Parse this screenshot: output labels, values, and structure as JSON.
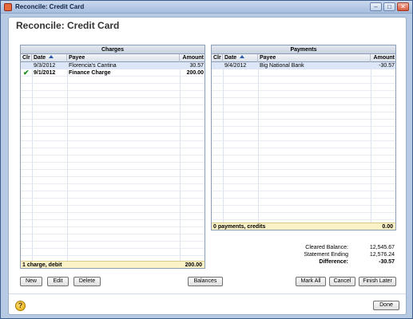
{
  "window": {
    "title": "Reconcile: Credit Card",
    "controls": {
      "minimize": "–",
      "maximize": "□",
      "close": "✕"
    }
  },
  "heading": "Reconcile: Credit Card",
  "charges": {
    "title": "Charges",
    "columns": {
      "clr": "Clr",
      "date": "Date",
      "payee": "Payee",
      "amount": "Amount"
    },
    "rows": [
      {
        "clr": "",
        "date": "9/3/2012",
        "payee": "Florencia's Cantina",
        "amount": "30.57",
        "cleared": false
      },
      {
        "clr": "✔",
        "date": "9/1/2012",
        "payee": "Finance Charge",
        "amount": "200.00",
        "cleared": true
      }
    ],
    "footer": {
      "label": "1 charge, debit",
      "total": "200.00"
    }
  },
  "payments": {
    "title": "Payments",
    "columns": {
      "clr": "Clr",
      "date": "Date",
      "payee": "Payee",
      "amount": "Amount"
    },
    "rows": [
      {
        "clr": "",
        "date": "9/4/2012",
        "payee": "Big National Bank",
        "amount": "-30.57",
        "cleared": false
      }
    ],
    "footer": {
      "label": "0 payments, credits",
      "total": "0.00"
    }
  },
  "summary": {
    "cleared_balance_label": "Cleared Balance:",
    "cleared_balance": "12,545.67",
    "statement_ending_label": "Statement Ending",
    "statement_ending": "12,576.24",
    "difference_label": "Difference:",
    "difference": "-30.57"
  },
  "buttons": {
    "new": "New",
    "edit": "Edit",
    "delete": "Delete",
    "balances": "Balances",
    "mark_all": "Mark All",
    "cancel": "Cancel",
    "finish_later": "Finish Later",
    "done": "Done"
  },
  "help_icon": "?",
  "icons": [
    "app-icon",
    "sort-ascending-icon",
    "checkmark-icon",
    "help-icon"
  ],
  "colors": {
    "title_bar": "#b7cae4",
    "footer_bar": "#fbf2c7",
    "selected_row": "#dce6f6",
    "check": "#1f8a1f"
  }
}
